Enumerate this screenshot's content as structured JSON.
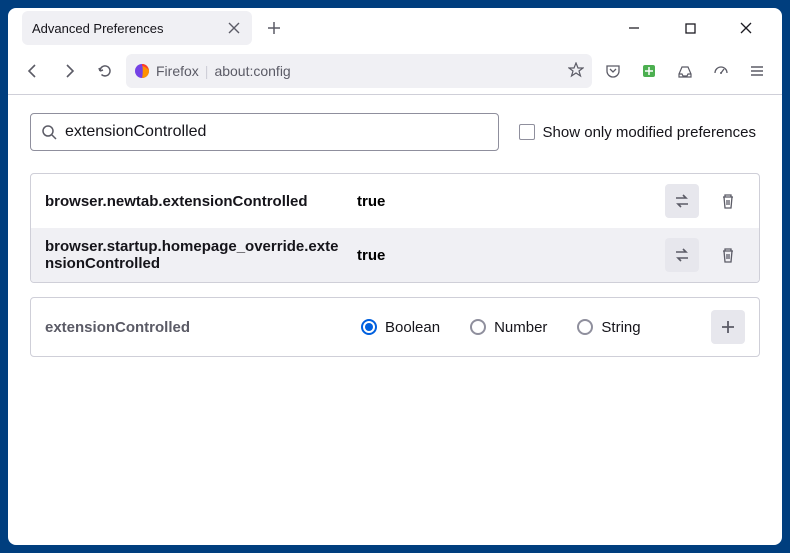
{
  "tab": {
    "title": "Advanced Preferences"
  },
  "urlbar": {
    "brand": "Firefox",
    "url": "about:config"
  },
  "search": {
    "value": "extensionControlled",
    "placeholder": ""
  },
  "checkbox": {
    "label": "Show only modified preferences"
  },
  "prefs": [
    {
      "name": "browser.newtab.extensionControlled",
      "value": "true"
    },
    {
      "name": "browser.startup.homepage_override.extensionControlled",
      "value": "true"
    }
  ],
  "addRow": {
    "name": "extensionControlled",
    "options": [
      "Boolean",
      "Number",
      "String"
    ],
    "selected": 0
  }
}
